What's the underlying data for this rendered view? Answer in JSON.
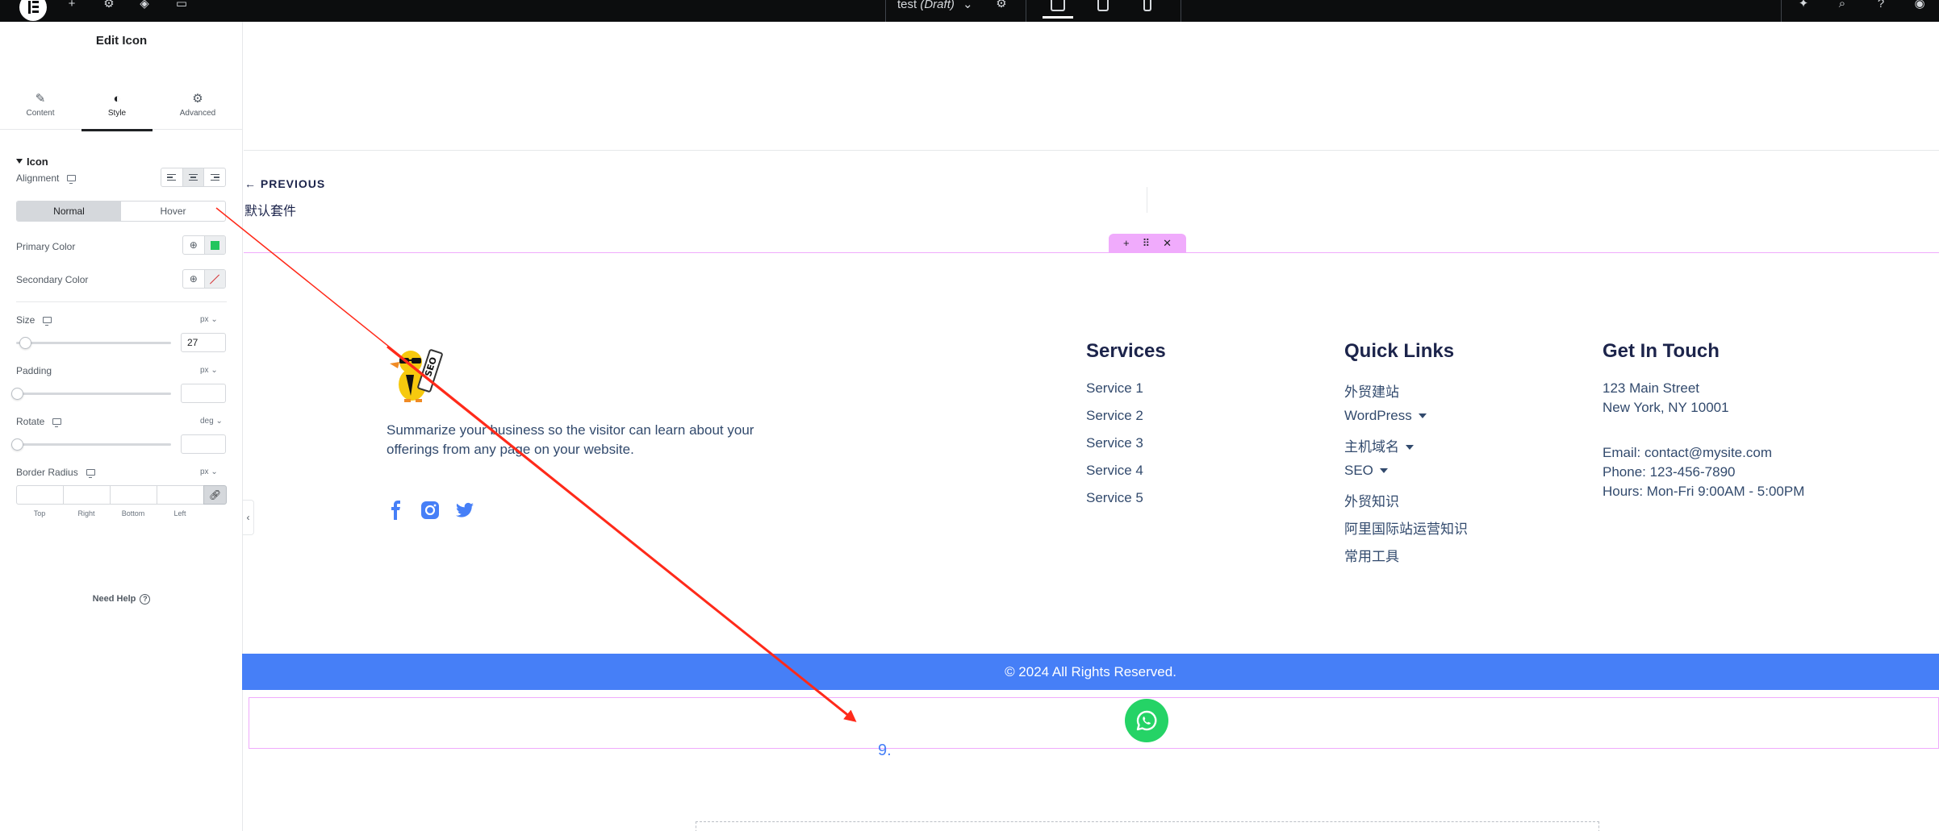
{
  "topbar": {
    "doc_name": "test",
    "doc_status": "(Draft)"
  },
  "panel": {
    "title": "Edit Icon",
    "tabs": [
      {
        "label": "Content",
        "icon": "pencil-icon"
      },
      {
        "label": "Style",
        "icon": "contrast-icon"
      },
      {
        "label": "Advanced",
        "icon": "gear-icon"
      }
    ],
    "section_title": "Icon",
    "alignment_label": "Alignment",
    "state_tabs": [
      "Normal",
      "Hover"
    ],
    "primary_color_label": "Primary Color",
    "primary_color": "#22c55e",
    "secondary_color_label": "Secondary Color",
    "size_label": "Size",
    "size_unit": "px",
    "size_value": "27",
    "padding_label": "Padding",
    "padding_unit": "px",
    "rotate_label": "Rotate",
    "rotate_unit": "deg",
    "border_radius_label": "Border Radius",
    "border_radius_unit": "px",
    "dimension_labels": [
      "Top",
      "Right",
      "Bottom",
      "Left"
    ],
    "help_label": "Need Help"
  },
  "post_nav": {
    "previous_label": "← PREVIOUS",
    "previous_title": "默认套件"
  },
  "footer": {
    "about_text": "Summarize your business so the visitor can learn about your offerings from any page on your website.",
    "services_title": "Services",
    "services": [
      "Service 1",
      "Service 2",
      "Service 3",
      "Service 4",
      "Service 5"
    ],
    "quick_links_title": "Quick Links",
    "quick_links": [
      {
        "label": "外贸建站",
        "dropdown": false
      },
      {
        "label": "WordPress",
        "dropdown": true
      },
      {
        "label": "主机域名",
        "dropdown": true
      },
      {
        "label": "SEO",
        "dropdown": true
      },
      {
        "label": "外贸知识",
        "dropdown": false
      },
      {
        "label": "阿里国际站运营知识",
        "dropdown": false
      },
      {
        "label": "常用工具",
        "dropdown": false
      }
    ],
    "contact_title": "Get In Touch",
    "address_line1": "123 Main Street",
    "address_line2": "New York, NY 10001",
    "email": "Email: contact@mysite.com",
    "phone": "Phone: 123-456-7890",
    "hours": "Hours: Mon-Fri 9:00AM - 5:00PM",
    "copyright": "© 2024 All Rights Reserved."
  },
  "annotation": {
    "step_number": "9."
  },
  "colors": {
    "accent_blue": "#467ff7",
    "heading_navy": "#1c244b",
    "whatsapp_green": "#25d366",
    "editor_pink": "#f0abfc",
    "arrow_red": "#ff2a1a"
  }
}
